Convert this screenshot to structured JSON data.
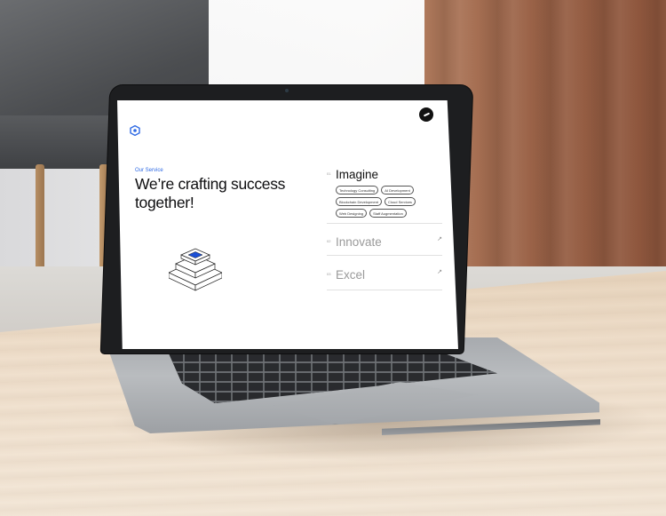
{
  "site": {
    "logo_icon": "hexagon-logo-icon",
    "profile_icon": "profile-icon"
  },
  "hero": {
    "eyebrow": "Our Service",
    "headline": "We’re crafting success together!",
    "illustration_icon": "stacked-layers-icon"
  },
  "services": [
    {
      "num": "01",
      "title": "Imagine",
      "expanded": true,
      "tags": [
        "Technology Consulting",
        "AI Development",
        "Blockchain Development",
        "Cloud Services",
        "Web Designing",
        "Staff Augmentation"
      ]
    },
    {
      "num": "02",
      "title": "Innovate",
      "expanded": false,
      "arrow": "↗"
    },
    {
      "num": "03",
      "title": "Excel",
      "expanded": false,
      "arrow": "↗"
    }
  ],
  "colors": {
    "accent": "#2f6ae4",
    "illustration_fill": "#1b4fd6",
    "text": "#0e0e10",
    "muted": "#9a9a9a"
  }
}
